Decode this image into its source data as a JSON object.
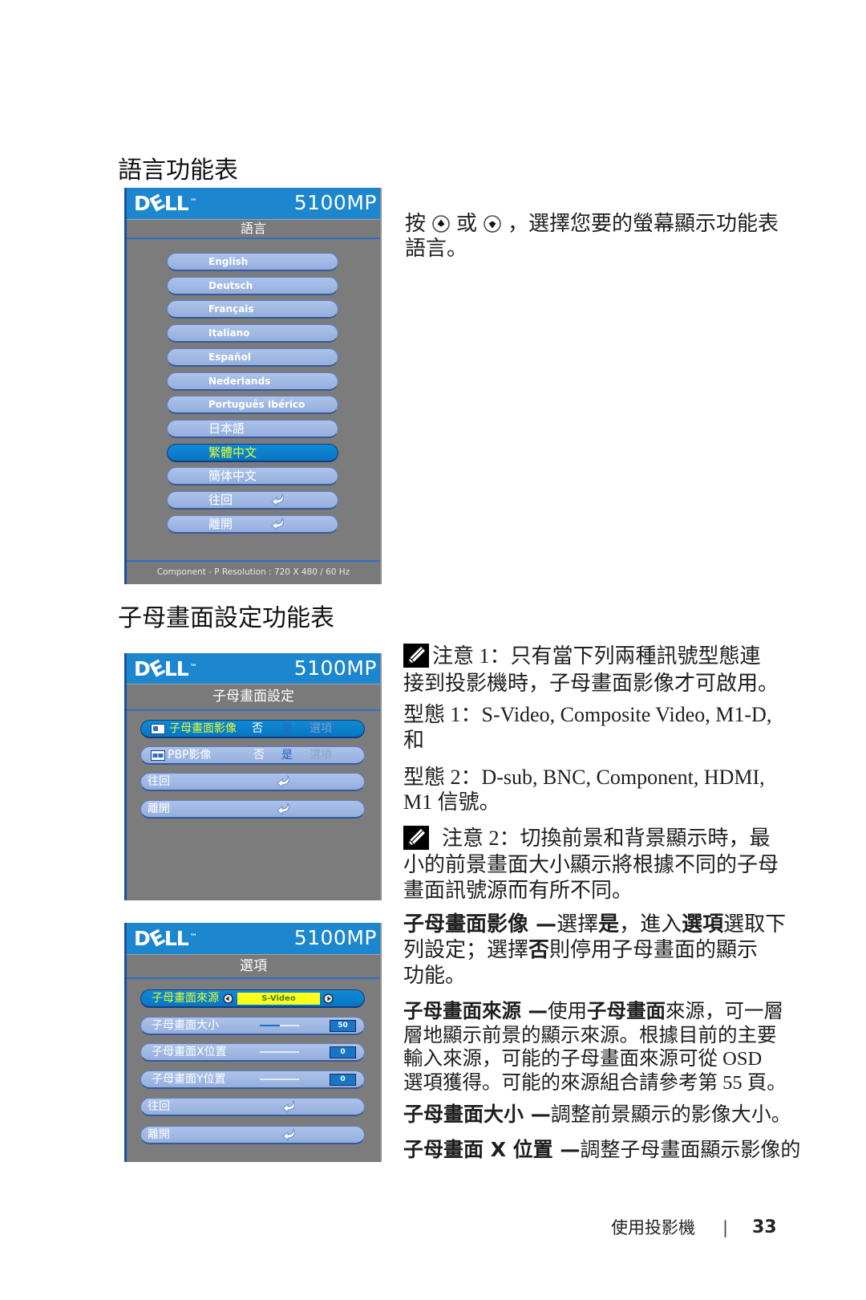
{
  "section_language": {
    "title": "語言功能表",
    "help": {
      "press": "按",
      "up_icon": "up-button-icon",
      "or": "或",
      "down_icon": "down-button-icon",
      "rest": "，選擇您要的螢幕顯示功能表",
      "line2": "語言。"
    }
  },
  "osd_language": {
    "brand": {
      "d": "D",
      "e": "E",
      "ll": "LL",
      "tm": "™"
    },
    "model": "5100MP",
    "menu_title": "語言",
    "items": [
      {
        "label": "English",
        "selected": false
      },
      {
        "label": "Deutsch",
        "selected": false
      },
      {
        "label": "Français",
        "selected": false
      },
      {
        "label": "Italiano",
        "selected": false
      },
      {
        "label": "Español",
        "selected": false
      },
      {
        "label": "Nederlands",
        "selected": false
      },
      {
        "label": "Português Ibérico",
        "selected": false
      },
      {
        "label": "日本語",
        "selected": false
      },
      {
        "label": "繁體中文",
        "selected": true
      },
      {
        "label": "簡体中文",
        "selected": false
      },
      {
        "label": "往回",
        "icon": "return-arrow-icon",
        "selected": false
      },
      {
        "label": "離開",
        "icon": "return-arrow-icon",
        "selected": false
      }
    ],
    "status": "Component - P Resolution : 720 X 480 / 60 Hz"
  },
  "section_pip": {
    "title": "子母畫面設定功能表",
    "note1": {
      "icon": "note-pencil-icon",
      "lines": [
        "注意 1：只有當下列兩種訊號型態連",
        "接到投影機時，子母畫面影像才可啟用。"
      ]
    },
    "type1": {
      "lines": [
        "型態 1：S-Video, Composite Video, M1-D,",
        "和"
      ]
    },
    "type2": {
      "lines": [
        "型態 2：D-sub, BNC, Component, HDMI,",
        "M1 信號。"
      ]
    },
    "note2": {
      "icon": "note-pencil-icon",
      "lines": [
        "注意 2：切換前景和背景顯示時，最",
        "小的前景畫面大小顯示將根據不同的子母",
        "畫面訊號源而有所不同。"
      ]
    },
    "pip_image": {
      "lines": [
        [
          {
            "text": "子母畫面影像 —",
            "bold": true
          },
          {
            "text": "選擇",
            "bold": false
          },
          {
            "text": "是",
            "bold": true
          },
          {
            "text": "，進入",
            "bold": false
          },
          {
            "text": "選項",
            "bold": true
          },
          {
            "text": "選取下",
            "bold": false
          }
        ],
        [
          {
            "text": "列設定；選擇",
            "bold": false
          },
          {
            "text": "否",
            "bold": true
          },
          {
            "text": "則停用子母畫面的顯示",
            "bold": false
          }
        ],
        [
          {
            "text": "功能。",
            "bold": false
          }
        ]
      ]
    },
    "pip_source": {
      "lines": [
        [
          {
            "text": "子母畫面來源 —",
            "bold": true
          },
          {
            "text": "使用",
            "bold": false
          },
          {
            "text": "子母畫面",
            "bold": true
          },
          {
            "text": "來源，可一層",
            "bold": false
          }
        ],
        [
          {
            "text": "層地顯示前景的顯示來源。根據目前的主要",
            "bold": false
          }
        ],
        [
          {
            "text": "輸入來源，可能的子母畫面來源可從 OSD",
            "bold": false
          }
        ],
        [
          {
            "text": "選項獲得。可能的來源組合請參考第 55 頁。",
            "bold": false
          }
        ]
      ]
    },
    "pip_size": {
      "lines": [
        [
          {
            "text": "子母畫面大小 —",
            "bold": true
          },
          {
            "text": "調整前景顯示的影像大小。",
            "bold": false
          }
        ]
      ]
    },
    "pip_x_position": {
      "lines": [
        [
          {
            "text": "子母畫面 X 位置 —",
            "bold": true
          },
          {
            "text": "調整子母畫面顯示影像的",
            "bold": false
          }
        ]
      ]
    }
  },
  "osd_pip": {
    "brand": {
      "d": "D",
      "e": "E",
      "ll": "LL",
      "tm": "™"
    },
    "model": "5100MP",
    "menu_title": "子母畫面設定",
    "rows": [
      {
        "icon": "pip-icon",
        "label": "子母畫面影像",
        "options": [
          "否",
          "是",
          "選項"
        ],
        "selected": true
      },
      {
        "icon": "pbp-icon",
        "label": "PBP影像",
        "options": [
          "否",
          "是",
          "選項"
        ],
        "selected": false
      },
      {
        "label": "往回",
        "icon": "return-arrow-icon",
        "selected": false
      },
      {
        "label": "離開",
        "icon": "return-arrow-icon",
        "selected": false
      }
    ]
  },
  "osd_options": {
    "brand": {
      "d": "D",
      "e": "E",
      "ll": "LL",
      "tm": "™"
    },
    "model": "5100MP",
    "menu_title": "選項",
    "rows": [
      {
        "label": "子母畫面來源",
        "value": "S-Video",
        "selected": true
      },
      {
        "label": "子母畫面大小",
        "value": "50",
        "slider_fill": 0.5,
        "selected": false
      },
      {
        "label": "子母畫面X位置",
        "value": "0",
        "slider_fill": 0,
        "selected": false
      },
      {
        "label": "子母畫面Y位置",
        "value": "0",
        "slider_fill": 0,
        "selected": false
      },
      {
        "label": "往回",
        "icon": "return-arrow-icon",
        "selected": false
      },
      {
        "label": "離開",
        "icon": "return-arrow-icon",
        "selected": false
      }
    ]
  },
  "footer": {
    "chapter": "使用投影機",
    "separator": "|",
    "page_number": "33"
  }
}
